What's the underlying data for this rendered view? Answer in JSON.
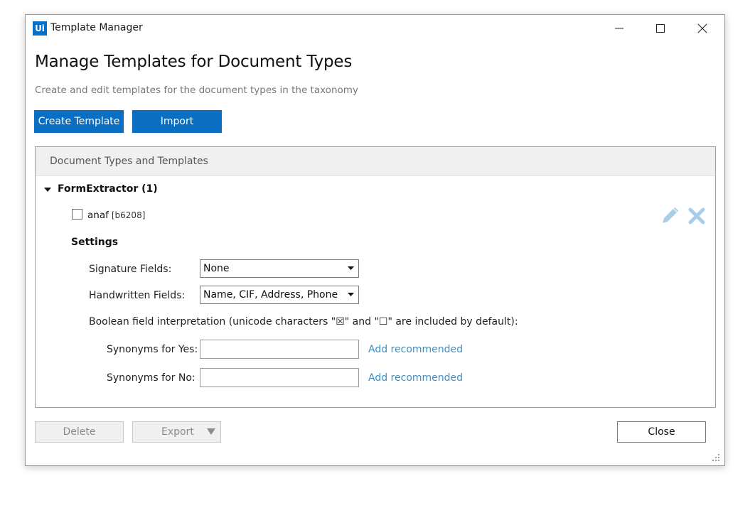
{
  "window": {
    "app_logo": "Ui",
    "title": "Template Manager"
  },
  "header": {
    "title": "Manage Templates for Document Types",
    "subtitle": "Create and edit templates for the document types in the taxonomy"
  },
  "toolbar": {
    "create_label": "Create Template",
    "import_label": "Import"
  },
  "panel": {
    "header": "Document Types and Templates",
    "document_type": {
      "name": "FormExtractor (1)",
      "expanded": true,
      "templates": [
        {
          "name": "anaf",
          "id": "[b6208]",
          "checked": false
        }
      ]
    },
    "settings": {
      "title": "Settings",
      "signature_label": "Signature Fields:",
      "signature_value": "None",
      "handwritten_label": "Handwritten Fields:",
      "handwritten_value": "Name, CIF, Address, Phone",
      "boolean_text": "Boolean field interpretation (unicode characters \"☒\" and \"☐\" are included by default):",
      "yes_label": "Synonyms for Yes:",
      "yes_value": "",
      "no_label": "Synonyms for No:",
      "no_value": "",
      "add_recommended": "Add recommended"
    }
  },
  "footer": {
    "delete_label": "Delete",
    "export_label": "Export",
    "close_label": "Close"
  },
  "colors": {
    "accent": "#0a6fc2",
    "link": "#3a8fc7",
    "icon_light": "#a9cfe8"
  },
  "icons": [
    "app-logo",
    "minimize-icon",
    "maximize-icon",
    "close-icon",
    "caret-down-icon",
    "pencil-icon",
    "x-icon",
    "dropdown-arrow-icon",
    "resize-grip-icon"
  ]
}
